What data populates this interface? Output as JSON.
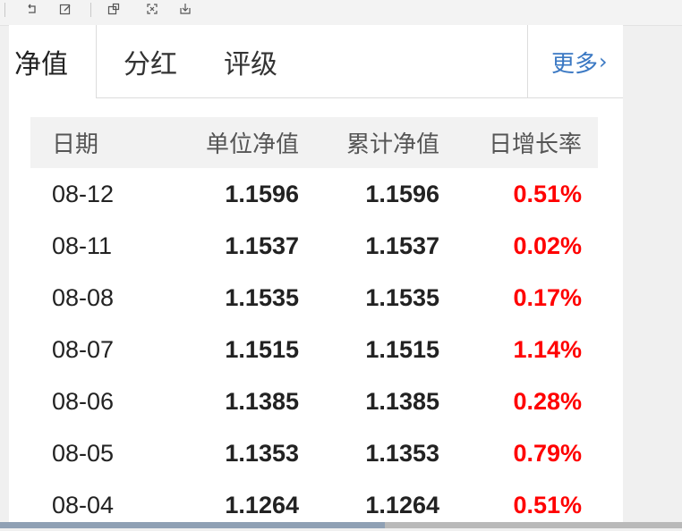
{
  "toolbar": {
    "icons": [
      "undo-icon",
      "edit-icon",
      "image-icon",
      "crop-icon",
      "download-icon"
    ]
  },
  "tabs": [
    {
      "label": "净值",
      "active": true
    },
    {
      "label": "分红",
      "active": false
    },
    {
      "label": "评级",
      "active": false
    }
  ],
  "more_label": "更多",
  "more_chevron": "›",
  "table": {
    "headers": [
      "日期",
      "单位净值",
      "累计净值",
      "日增长率"
    ],
    "rows": [
      {
        "date": "08-12",
        "nav": "1.1596",
        "acc_nav": "1.1596",
        "rate": "0.51%"
      },
      {
        "date": "08-11",
        "nav": "1.1537",
        "acc_nav": "1.1537",
        "rate": "0.02%"
      },
      {
        "date": "08-08",
        "nav": "1.1535",
        "acc_nav": "1.1535",
        "rate": "0.17%"
      },
      {
        "date": "08-07",
        "nav": "1.1515",
        "acc_nav": "1.1515",
        "rate": "1.14%"
      },
      {
        "date": "08-06",
        "nav": "1.1385",
        "acc_nav": "1.1385",
        "rate": "0.28%"
      },
      {
        "date": "08-05",
        "nav": "1.1353",
        "acc_nav": "1.1353",
        "rate": "0.79%"
      },
      {
        "date": "08-04",
        "nav": "1.1264",
        "acc_nav": "1.1264",
        "rate": "0.51%"
      }
    ]
  },
  "colors": {
    "rate_up": "#ff0000",
    "link": "#3a78c3"
  }
}
